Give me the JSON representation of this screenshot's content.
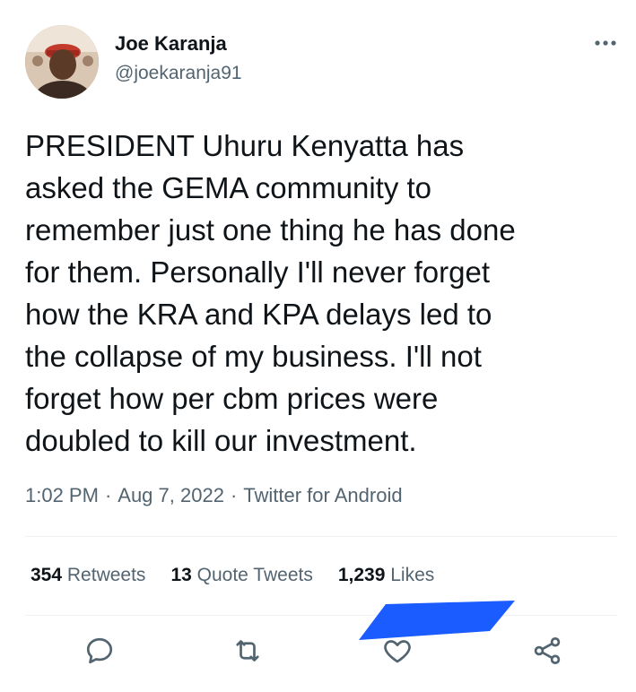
{
  "author": {
    "display_name": "Joe Karanja",
    "handle": "@joekaranja91",
    "avatar_icon": "avatar-photo"
  },
  "tweet": {
    "text": "PRESIDENT Uhuru Kenyatta has\nasked the GEMA community to\nremember just one thing he has done\nfor them. Personally I'll never forget\nhow the KRA and KPA delays led to\nthe collapse of my business.  I'll not\nforget how per cbm prices were\ndoubled to kill our investment."
  },
  "meta": {
    "time": "1:02 PM",
    "separator": "·",
    "date": "Aug 7, 2022",
    "source": "Twitter for Android"
  },
  "stats": {
    "retweets_count": "354",
    "retweets_label": "Retweets",
    "quote_tweets_count": "13",
    "quote_tweets_label": "Quote Tweets",
    "likes_count": "1,239",
    "likes_label": "Likes"
  },
  "actions": {
    "reply_icon": "reply-icon",
    "retweet_icon": "retweet-icon",
    "like_icon": "heart-icon",
    "share_icon": "share-icon"
  },
  "colors": {
    "text_primary": "#0f1419",
    "text_secondary": "#536471",
    "divider": "#eff3f4",
    "redaction_blue": "#1a5cff"
  }
}
